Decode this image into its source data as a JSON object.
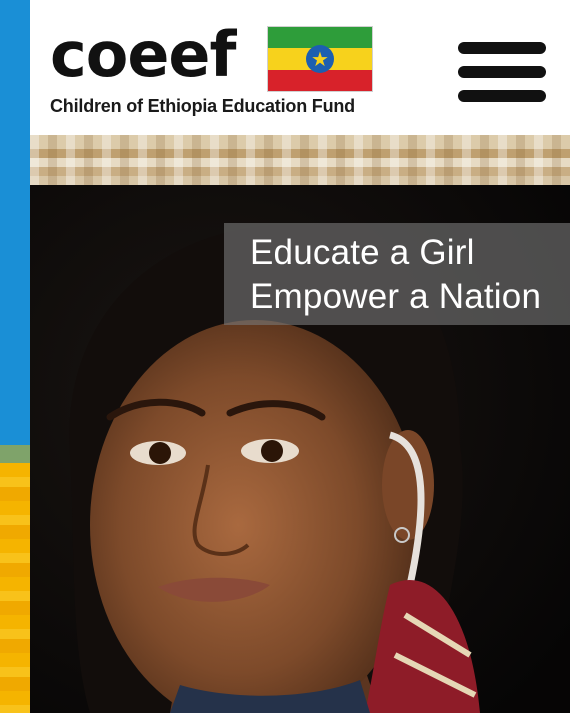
{
  "header": {
    "logo_text": "coeef",
    "tagline": "Children of Ethiopia Education Fund",
    "flag_icon": "ethiopia-flag-icon",
    "menu_icon": "hamburger-menu-icon"
  },
  "hero": {
    "headline_line1": "Educate a Girl",
    "headline_line2": "Empower a Nation"
  },
  "colors": {
    "stripe_blue": "#1a8fd6",
    "stripe_gold": "#f5b400",
    "flag_green": "#2e9d3a",
    "flag_yellow": "#f7d21c",
    "flag_red": "#d8222a",
    "flag_emblem": "#1c5fb0",
    "headline_overlay": "#787878"
  }
}
